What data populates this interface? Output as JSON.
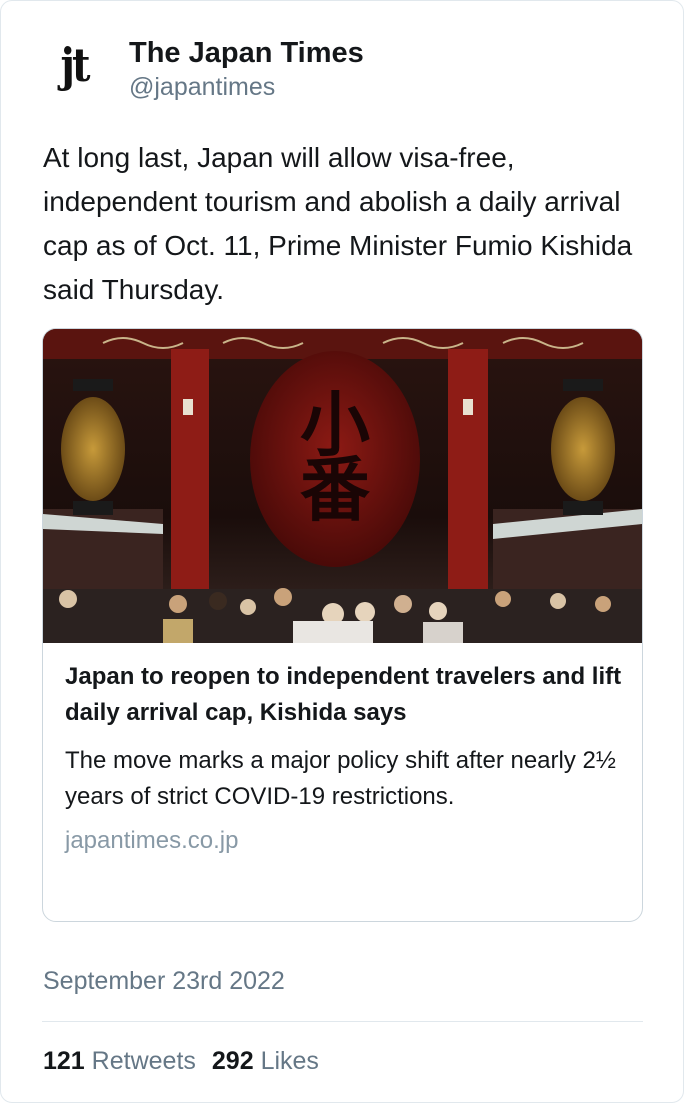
{
  "account": {
    "avatar_text": "jt",
    "display_name": "The Japan Times",
    "handle": "@japantimes"
  },
  "tweet": {
    "text": "At long last, Japan will allow visa-free, independent tourism and abolish a daily arrival cap as of Oct. 11, Prime Minister Fumio Kishida said Thursday."
  },
  "card": {
    "image": "photo of crowd of masked visitors beneath large red lantern at Senso-ji temple gate",
    "title": "Japan to reopen to independent travelers and lift daily arrival cap, Kishida says",
    "description": "The move marks a major policy shift after nearly 2½ years of strict COVID-19 restrictions.",
    "domain": "japantimes.co.jp"
  },
  "timestamp": "September 23rd 2022",
  "stats": {
    "retweets_count": "121",
    "retweets_label": "Retweets",
    "likes_count": "292",
    "likes_label": "Likes"
  },
  "colors": {
    "text": "#14171a",
    "secondary": "#657786",
    "domain": "#8899a6",
    "border": "#e1e8ed"
  }
}
